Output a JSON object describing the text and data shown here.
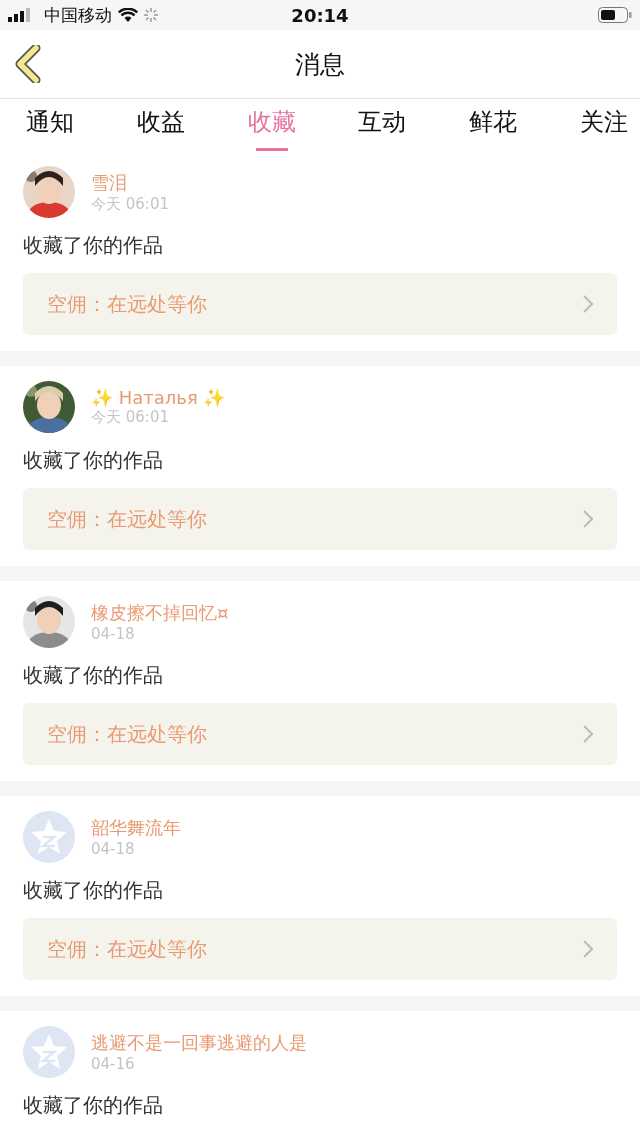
{
  "status_bar": {
    "carrier": "中国移动",
    "time": "20:14"
  },
  "nav": {
    "title": "消息"
  },
  "tabs": [
    {
      "label": "通知",
      "selected": false
    },
    {
      "label": "收益",
      "selected": false
    },
    {
      "label": "收藏",
      "selected": true
    },
    {
      "label": "互动",
      "selected": false
    },
    {
      "label": "鲜花",
      "selected": false
    },
    {
      "label": "关注",
      "selected": false
    }
  ],
  "messages": [
    {
      "name": "雪泪",
      "time": "今天 06:01",
      "text": "收藏了你的作品",
      "link": "空佣：在远处等你"
    },
    {
      "name": "✨ Наталья ✨",
      "time": "今天 06:01",
      "text": "收藏了你的作品",
      "link": "空佣：在远处等你"
    },
    {
      "name": "橡皮擦不掉回忆¤",
      "time": "04-18",
      "text": "收藏了你的作品",
      "link": "空佣：在远处等你"
    },
    {
      "avatar": {
        "kind": "default"
      },
      "name": "韶华舞流年",
      "time": "04-18",
      "text": "收藏了你的作品",
      "link": "空佣：在远处等你"
    },
    {
      "avatar": {
        "kind": "default"
      },
      "name": "逃避不是一回事逃避的人是",
      "time": "04-16",
      "text": "收藏了你的作品"
    }
  ]
}
